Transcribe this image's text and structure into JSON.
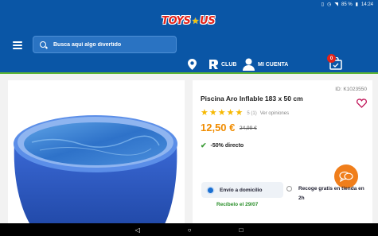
{
  "status_bar": {
    "battery": "85 %",
    "time": "14:24"
  },
  "header": {
    "logo": {
      "left": "TOYS",
      "right": "US"
    },
    "search": {
      "placeholder": "Busca aquí algo divertido"
    },
    "nav": {
      "club_label": "CLUB",
      "account_label": "MI CUENTA",
      "cart_count": "0"
    }
  },
  "product": {
    "id": "ID: K1023550",
    "title": "Piscina Aro Inflable 183 x 50 cm",
    "rating": {
      "value": "5 (1)",
      "opinions_link": "Ver opiniones"
    },
    "price": "12,50 €",
    "old_price": "24,99 €",
    "discount": "-50% directo"
  },
  "shipping": {
    "delivery_label": "Envío a domicilio",
    "pickup_label": "Recoge gratis en tienda en 2h",
    "receive_date": "Recíbelo el 29/07"
  },
  "colors": {
    "brand_blue": "#0a56a6",
    "accent_green": "#5db535",
    "price_orange": "#f08c00",
    "chat_orange": "#f07e1b",
    "logo_red": "#e2231a"
  },
  "icons": [
    "menu-icon",
    "search-icon",
    "location-pin-icon",
    "club-icon",
    "user-icon",
    "cart-icon",
    "heart-icon",
    "star-icon",
    "check-icon",
    "chat-icon",
    "back-icon",
    "home-icon",
    "recents-icon"
  ]
}
